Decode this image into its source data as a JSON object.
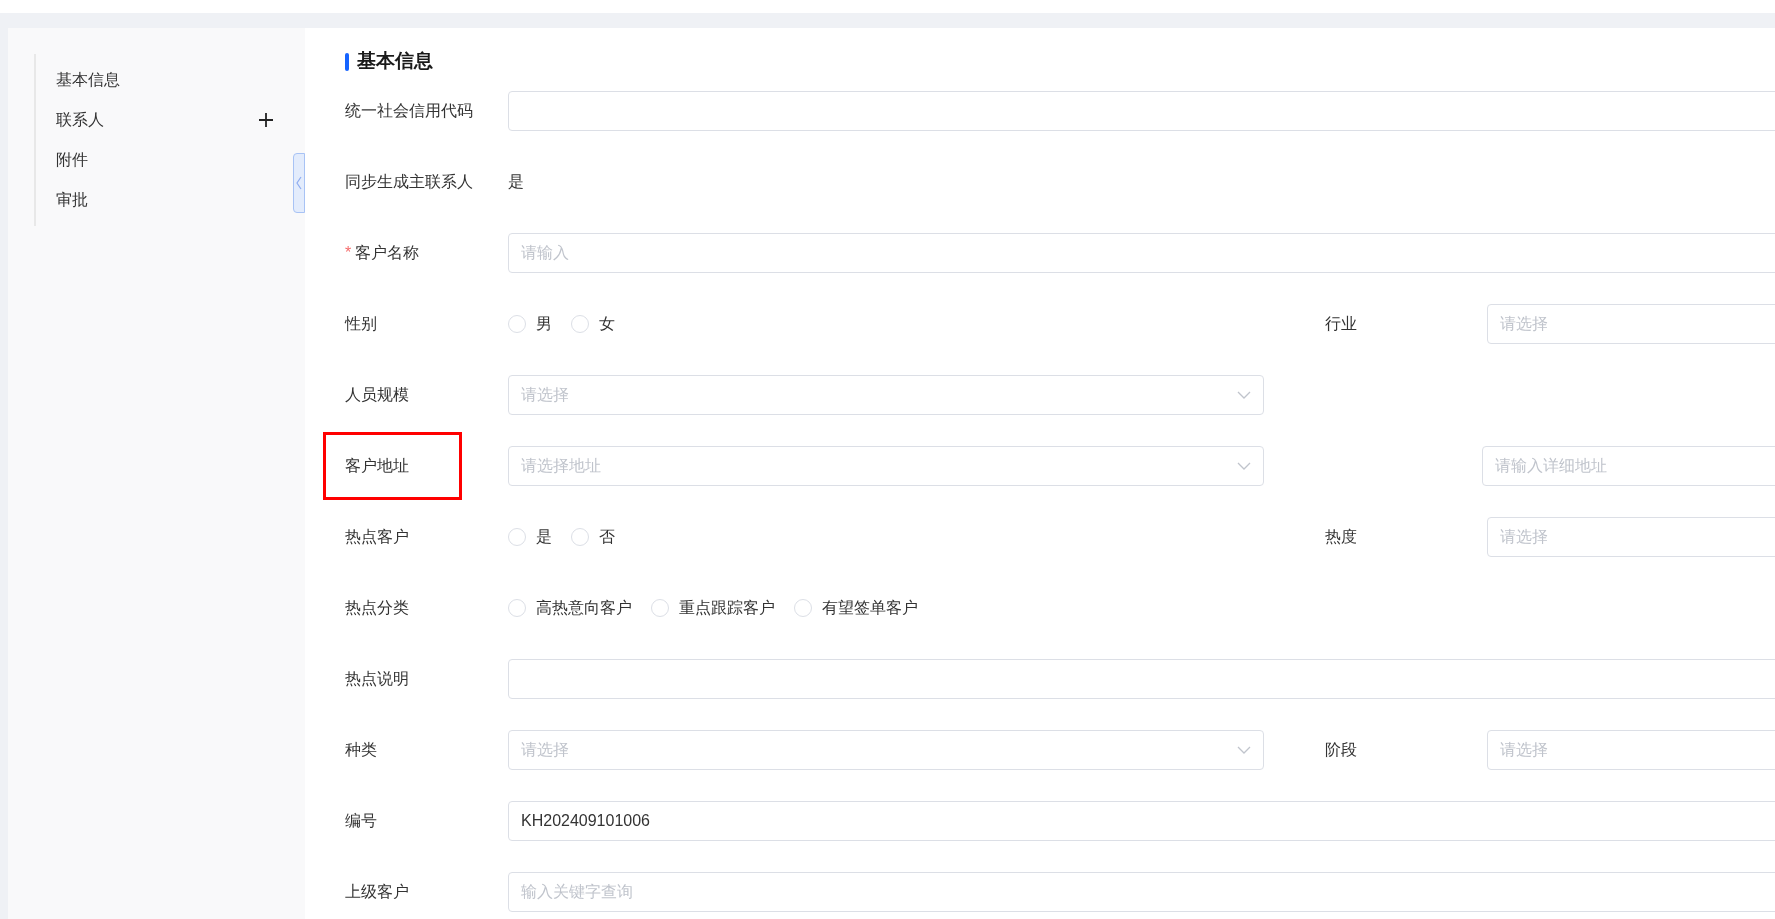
{
  "sidebar": {
    "items": [
      {
        "label": "基本信息",
        "has_add": false
      },
      {
        "label": "联系人",
        "has_add": true
      },
      {
        "label": "附件",
        "has_add": false
      },
      {
        "label": "审批",
        "has_add": false
      }
    ]
  },
  "section_title": "基本信息",
  "rows": [
    {
      "fields": [
        {
          "label": "统一社会信用代码",
          "kind": "input",
          "highlighted": false
        }
      ]
    },
    {
      "fields": [
        {
          "label": "同步生成主联系人",
          "kind": "text",
          "value": "是",
          "highlighted": false
        }
      ]
    },
    {
      "fields": [
        {
          "required_mark": "*",
          "label": "客户名称",
          "kind": "input",
          "placeholder": "请输入",
          "highlighted": false
        }
      ]
    },
    {
      "fields": [
        {
          "label": "性别",
          "kind": "radio",
          "options": [
            {
              "label": "男",
              "selected": false
            },
            {
              "label": "女",
              "selected": false
            }
          ],
          "highlighted": false
        },
        {
          "label": "行业",
          "kind": "input",
          "placeholder": "请选择",
          "highlighted": false
        }
      ]
    },
    {
      "fields": [
        {
          "label": "人员规模",
          "kind": "select",
          "placeholder": "请选择",
          "highlighted": false
        }
      ]
    },
    {
      "fields": [
        {
          "label": "客户地址",
          "kind": "select",
          "placeholder": "请选择地址",
          "highlighted": true
        },
        {
          "kind": "input",
          "placeholder": "请输入详细地址"
        }
      ]
    },
    {
      "fields": [
        {
          "label": "热点客户",
          "kind": "radio",
          "options": [
            {
              "label": "是",
              "selected": false
            },
            {
              "label": "否",
              "selected": false
            }
          ],
          "highlighted": false
        },
        {
          "label": "热度",
          "kind": "input",
          "placeholder": "请选择",
          "highlighted": false
        }
      ]
    },
    {
      "fields": [
        {
          "label": "热点分类",
          "kind": "radio",
          "options": [
            {
              "label": "高热意向客户",
              "selected": false
            },
            {
              "label": "重点跟踪客户",
              "selected": false
            },
            {
              "label": "有望签单客户",
              "selected": false
            }
          ],
          "highlighted": false
        }
      ]
    },
    {
      "fields": [
        {
          "label": "热点说明",
          "kind": "input",
          "highlighted": false
        }
      ]
    },
    {
      "fields": [
        {
          "label": "种类",
          "kind": "select",
          "placeholder": "请选择",
          "highlighted": false
        },
        {
          "label": "阶段",
          "kind": "input",
          "placeholder": "请选择",
          "highlighted": false
        }
      ]
    },
    {
      "fields": [
        {
          "label": "编号",
          "kind": "input",
          "value": "KH202409101006",
          "highlighted": false
        }
      ]
    },
    {
      "fields": [
        {
          "label": "上级客户",
          "kind": "input",
          "placeholder": "输入关键字查询",
          "highlighted": false
        }
      ]
    }
  ]
}
